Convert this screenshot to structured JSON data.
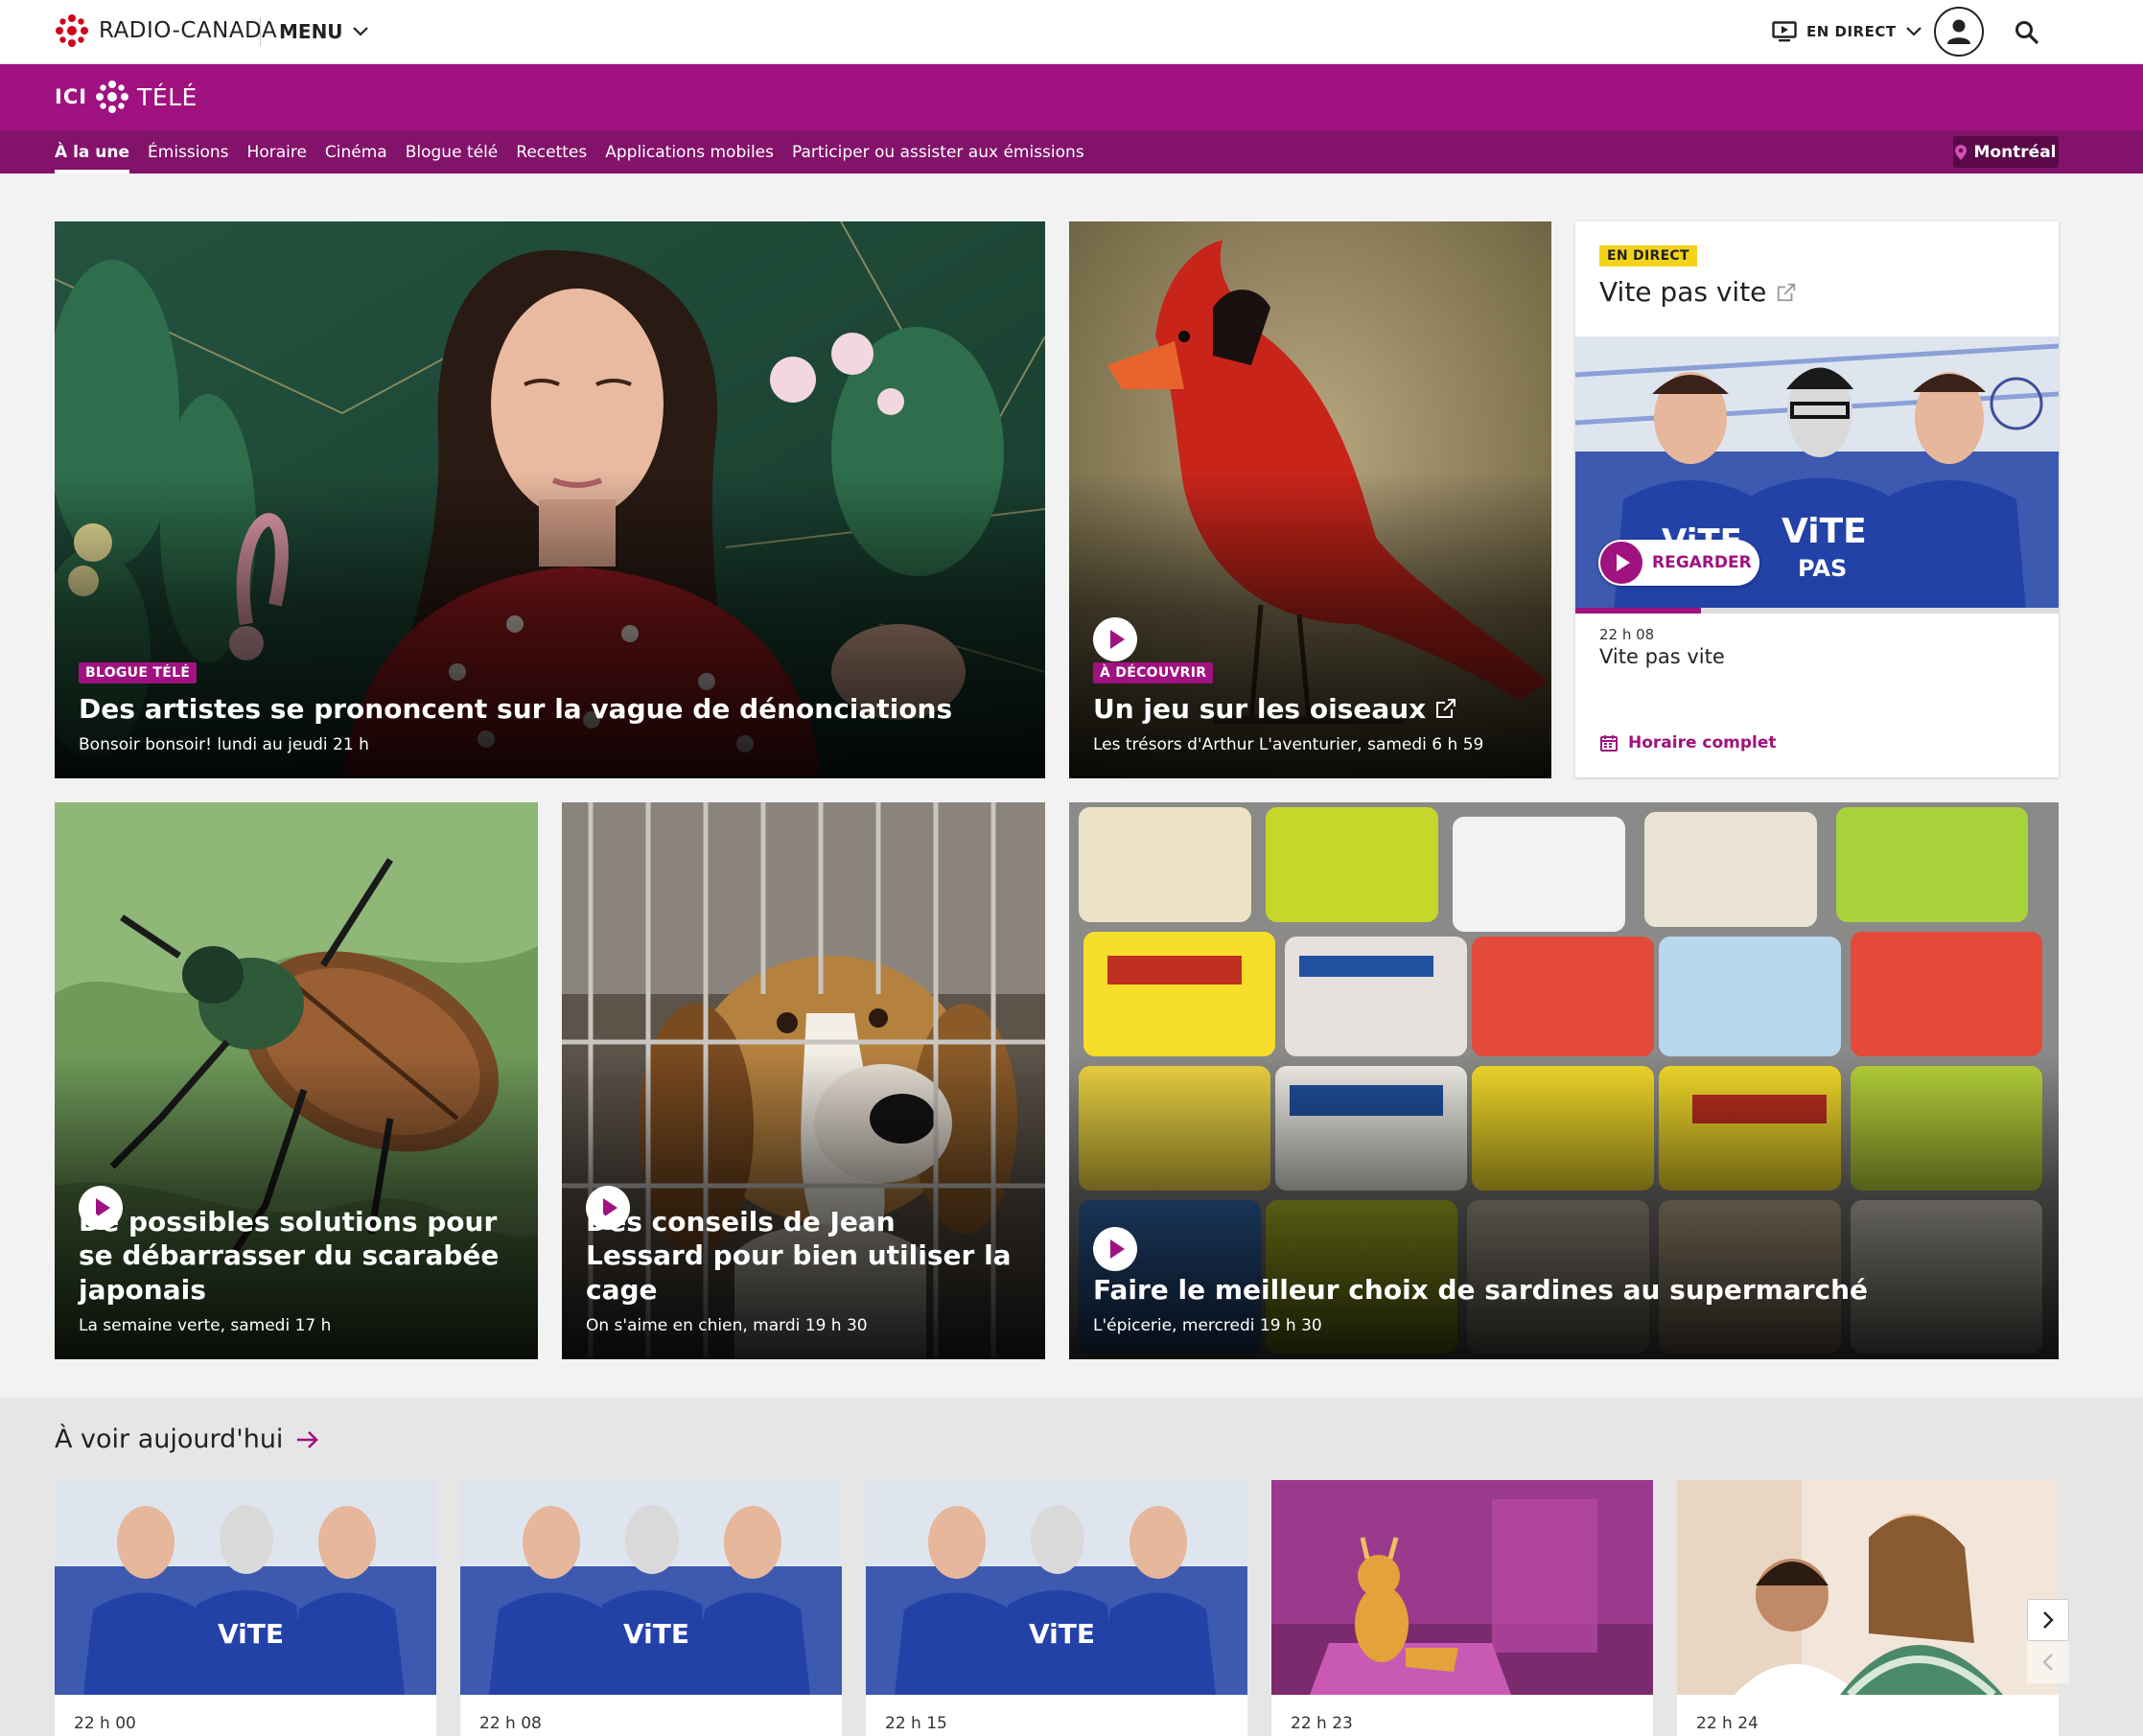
{
  "header": {
    "brand_name": "RADIO-CANADA",
    "menu_label": "MENU",
    "live_label": "EN DIRECT",
    "brand_color": "#a0127f"
  },
  "brandbar": {
    "ici": "ICI",
    "tele": "TÉLÉ"
  },
  "nav": {
    "items": [
      {
        "label": "À la une",
        "active": true
      },
      {
        "label": "Émissions"
      },
      {
        "label": "Horaire"
      },
      {
        "label": "Cinéma"
      },
      {
        "label": "Blogue télé"
      },
      {
        "label": "Recettes"
      },
      {
        "label": "Applications mobiles"
      },
      {
        "label": "Participer ou assister aux émissions"
      }
    ],
    "city": "Montréal"
  },
  "features": [
    {
      "tag": "BLOGUE TÉLÉ",
      "title": "Des artistes se prononcent sur la vague de dénonciations",
      "subtitle": "Bonsoir bonsoir! lundi au jeudi 21 h"
    },
    {
      "tag": "À DÉCOUVRIR",
      "title": "Un jeu sur les oiseaux",
      "subtitle": "Les trésors d'Arthur L'aventurier, samedi 6 h 59"
    },
    {
      "title": "De possibles solutions pour se débarrasser du scarabée japonais",
      "subtitle": "La semaine verte, samedi 17 h"
    },
    {
      "title": "Des conseils de Jean Lessard pour bien utiliser la cage",
      "subtitle": "On s'aime en chien, mardi 19 h 30"
    },
    {
      "title": "Faire le meilleur choix de sardines au supermarché",
      "subtitle": "L'épicerie, mercredi 19 h 30"
    }
  ],
  "live": {
    "badge": "EN DIRECT",
    "title": "Vite pas vite",
    "watch_label": "REGARDER",
    "time": "22 h 08",
    "show": "Vite pas vite",
    "schedule_label": "Horaire complet",
    "progress": 0.26
  },
  "today": {
    "heading": "À voir aujourd'hui",
    "items": [
      {
        "time": "22 h 00"
      },
      {
        "time": "22 h 08"
      },
      {
        "time": "22 h 15"
      },
      {
        "time": "22 h 23"
      },
      {
        "time": "22 h 24"
      }
    ]
  }
}
